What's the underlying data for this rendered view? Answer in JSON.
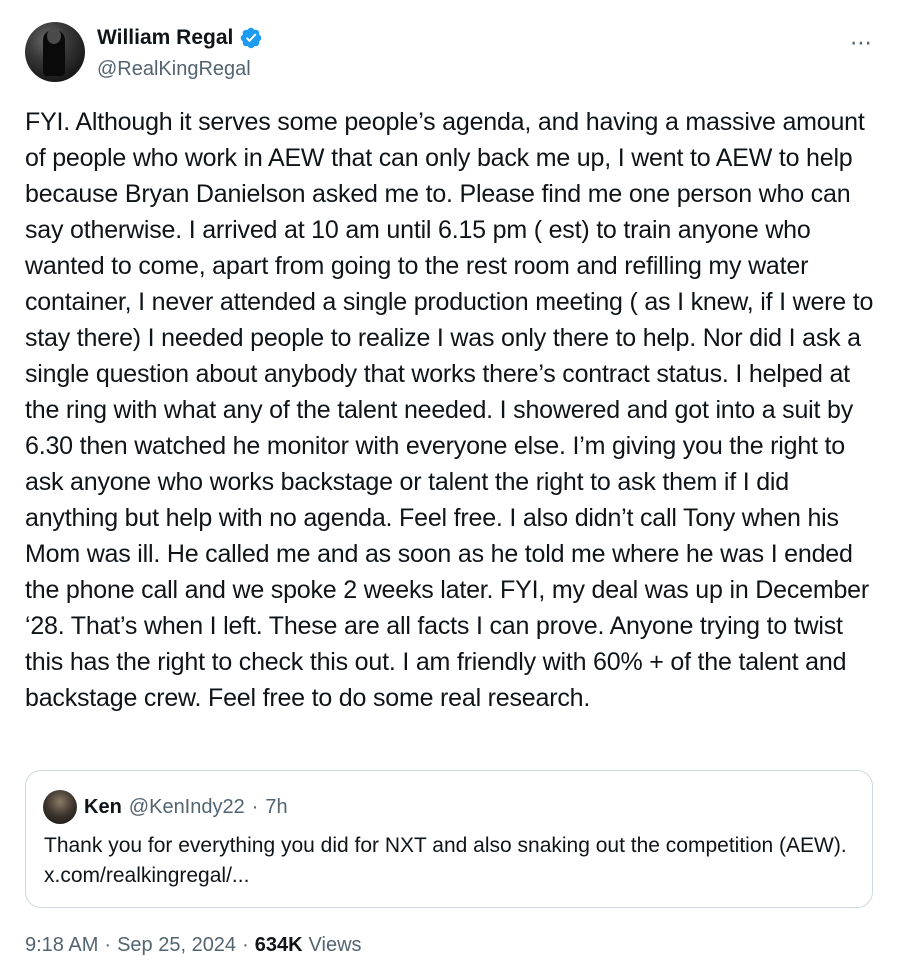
{
  "author": {
    "name": "William Regal",
    "handle": "@RealKingRegal"
  },
  "more_icon": "⋯",
  "icons": {
    "verified": "verified-badge-icon",
    "more": "more-options-icon"
  },
  "colors": {
    "verified": "#1d9bf0",
    "text": "#0f1419",
    "secondary": "#536471",
    "border": "#cfd9de"
  },
  "tweet": {
    "text": "FYI. Although it serves some people’s agenda, and having a massive amount of people who work in AEW that can only back me up, I went to AEW to help because Bryan Danielson asked me to. Please find me one person who can say otherwise. I arrived at 10 am until 6.15 pm ( est) to train anyone who wanted to come, apart from going to the rest room and refilling my water container, I never attended a single production meeting ( as I knew, if I were to stay there) I needed people to realize I was only there to help. Nor did I ask a single question about anybody that works there’s contract status. I helped at the ring with what any of the talent needed. I showered and got into a suit by 6.30 then watched he monitor with everyone else. I’m giving you the right to ask anyone who works backstage or talent the right to ask them if I did anything but help with no agenda. Feel free. I also didn’t call Tony when his Mom was ill. He called me and as soon as he told me where he was I ended the phone call and we spoke 2 weeks later. FYI, my deal was up in December ‘28. That’s when I left. These are all facts I can prove. Anyone trying to twist this has the right to check this out. I am friendly with 60% + of the talent and backstage crew. Feel free to do some real research."
  },
  "quote": {
    "name": "Ken",
    "handle": "@KenIndy22",
    "separator": "·",
    "time": "7h",
    "text": "Thank you for everything you did for NXT and also snaking out the competition (AEW). x.com/realkingregal/..."
  },
  "meta": {
    "time": "9:18 AM",
    "separator": "·",
    "date": "Sep 25, 2024",
    "views_count": "634K",
    "views_label": "Views"
  }
}
